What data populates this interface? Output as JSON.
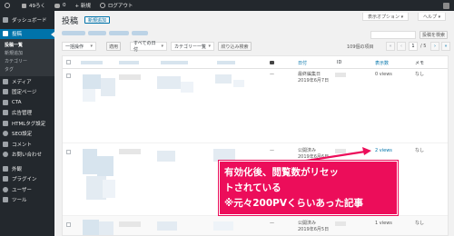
{
  "admin_bar": {
    "site_name": "49ろく",
    "comments_count": "0",
    "new_label": "+ 新規",
    "logout_label": "ログアウト"
  },
  "sidebar": {
    "dashboard": "ダッシュボード",
    "posts": "投稿",
    "sub_items": [
      "投稿一覧",
      "新規追加",
      "カテゴリー",
      "タグ"
    ],
    "items": [
      "メディア",
      "固定ページ",
      "CTA",
      "広告管理",
      "HTMLタグ設定",
      "SEO設定",
      "コメント",
      "お問い合わせ"
    ],
    "items2": [
      "外観",
      "プラグイン",
      "ユーザー",
      "ツール"
    ]
  },
  "header": {
    "title": "投稿",
    "add_new": "新規追加",
    "screen_options": "表示オプション ▾",
    "help": "ヘルプ ▾",
    "search_button": "投稿を検索"
  },
  "filters": {
    "bulk_action": "一括操作",
    "apply": "適用",
    "dates": "すべての日付",
    "category": "カテゴリー一覧",
    "filter_button": "絞り込み検索",
    "items_count": "109個の項目",
    "pagination": [
      "«",
      "‹"
    ],
    "pagination_next": [
      "›",
      "»"
    ],
    "current_page": "1",
    "total_pages": "/ 5"
  },
  "table": {
    "columns": {
      "date": "日付",
      "id": "ID",
      "views": "表示数",
      "memo": "メモ"
    },
    "rows": [
      {
        "comments": "—",
        "status": "最終編集日",
        "date": "2019年6月7日",
        "views": "0 views",
        "memo": "なし"
      },
      {
        "comments": "—",
        "status": "公開済み",
        "date": "2019年6月6日",
        "views": "2 views",
        "memo": "なし"
      },
      {
        "comments": "—",
        "status": "公開済み",
        "date": "2019年6月5日",
        "views": "1 views",
        "memo": "なし"
      }
    ]
  },
  "annotation": {
    "lines": [
      "有効化後、閲覧数がリセッ",
      "トされている",
      "※元々200PVくらいあった記事"
    ],
    "color": "#ec0d5a"
  }
}
